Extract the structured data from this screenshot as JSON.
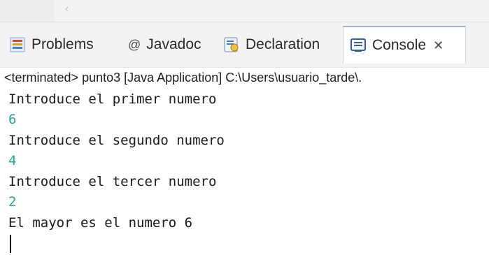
{
  "tabs": {
    "problems_label": "Problems",
    "javadoc_label": "Javadoc",
    "declaration_label": "Declaration",
    "console_label": "Console",
    "javadoc_prefix": "@",
    "close_glyph": "✕"
  },
  "console": {
    "status": "<terminated> punto3 [Java Application] C:\\Users\\usuario_tarde\\.",
    "lines": [
      {
        "text": "Introduce el primer numero",
        "kind": "output"
      },
      {
        "text": "6",
        "kind": "input"
      },
      {
        "text": "Introduce el segundo numero",
        "kind": "output"
      },
      {
        "text": "4",
        "kind": "input"
      },
      {
        "text": "Introduce el tercer numero",
        "kind": "output"
      },
      {
        "text": "2",
        "kind": "input"
      },
      {
        "text": "El mayor es el numero 6",
        "kind": "output"
      }
    ]
  },
  "colors": {
    "input_text": "#2aa198",
    "output_text": "#1b1b1b",
    "accent_blue": "#2f5fa7"
  },
  "icons": [
    "chevron-left-icon",
    "problems-icon",
    "declaration-icon",
    "console-icon",
    "close-icon"
  ]
}
